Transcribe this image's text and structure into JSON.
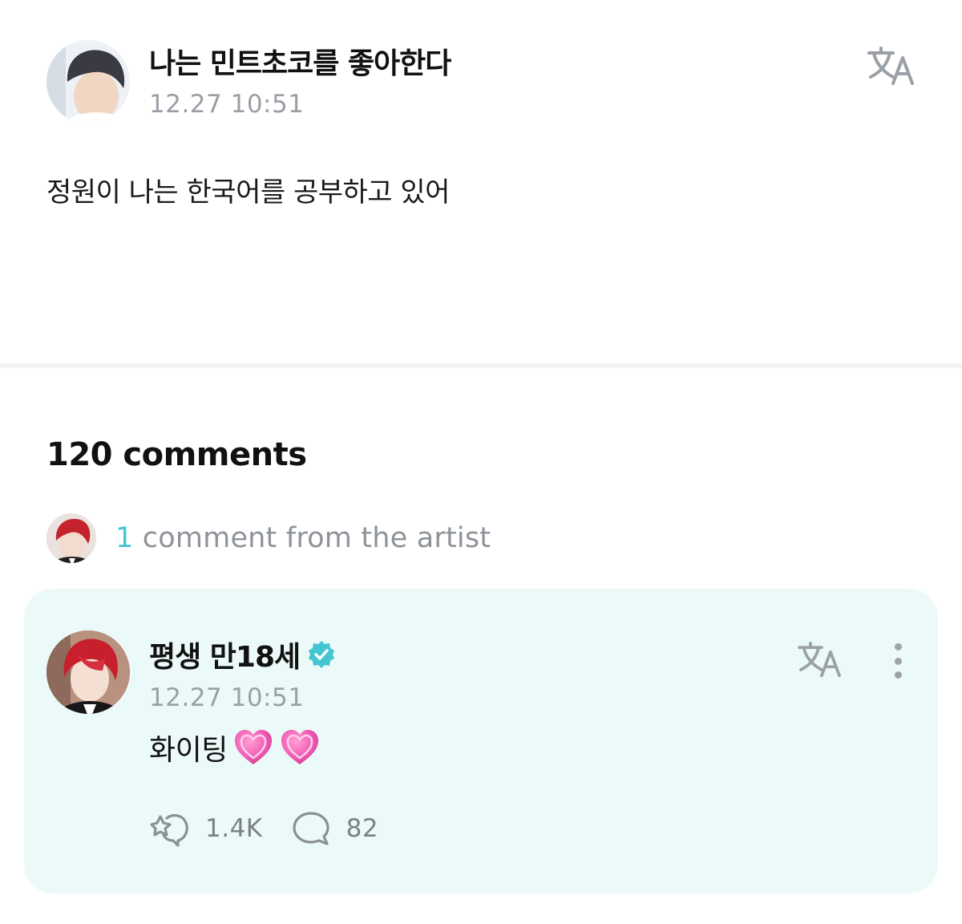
{
  "post": {
    "author": "나는 민트초코를 좋아한다",
    "timestamp": "12.27 10:51",
    "body": "정원이 나는 한국어를 공부하고 있어",
    "translate_icon": "translate-icon"
  },
  "comments": {
    "count_label": "120 comments",
    "artist_strip": {
      "count": "1",
      "label": " comment from the artist"
    },
    "artist_comment": {
      "author": "평생 만18세",
      "verified_icon": "verified-badge-icon",
      "timestamp": "12.27 10:51",
      "text": "화이팅",
      "emoji": [
        "pink-heart",
        "pink-heart"
      ],
      "likes": "1.4K",
      "replies": "82",
      "background_color": "#ebfaf8"
    }
  },
  "colors": {
    "accent": "#43c6d2",
    "muted_text": "#9a9fa6"
  }
}
